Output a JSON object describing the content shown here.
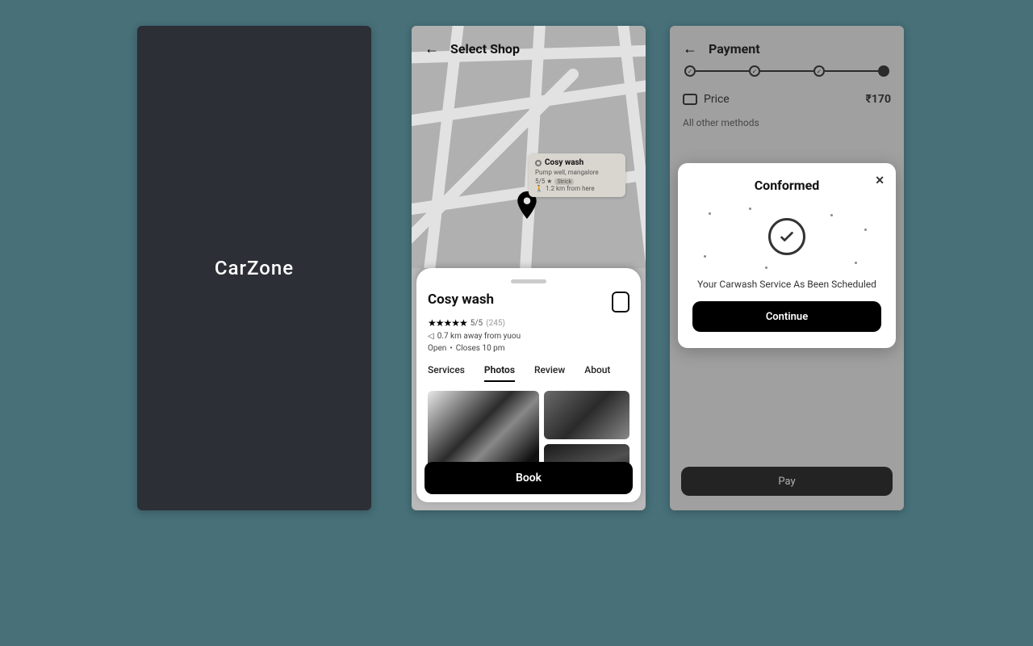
{
  "splash": {
    "brand": "CarZone"
  },
  "selectShop": {
    "headerTitle": "Select Shop",
    "mapTooltip": {
      "name": "Cosy wash",
      "address": "Pump well, mangalore",
      "rating": "5/5 ★",
      "badge": "Strick",
      "distance": "1.2 km from here"
    },
    "shopName": "Cosy wash",
    "ratingText": "5/5",
    "ratingCount": "(245)",
    "distance": "0.7 km away from yuou",
    "openStatus": "Open",
    "closes": "Closes 10 pm",
    "tabs": {
      "services": "Services",
      "photos": "Photos",
      "review": "Review",
      "about": "About"
    },
    "bookLabel": "Book"
  },
  "payment": {
    "headerTitle": "Payment",
    "priceLabel": "Price",
    "priceValue": "₹170",
    "methodsLabel": "All other methods",
    "payLabel": "Pay",
    "dialog": {
      "title": "Conformed",
      "message": "Your Carwash Service As Been Scheduled",
      "continueLabel": "Continue"
    }
  }
}
